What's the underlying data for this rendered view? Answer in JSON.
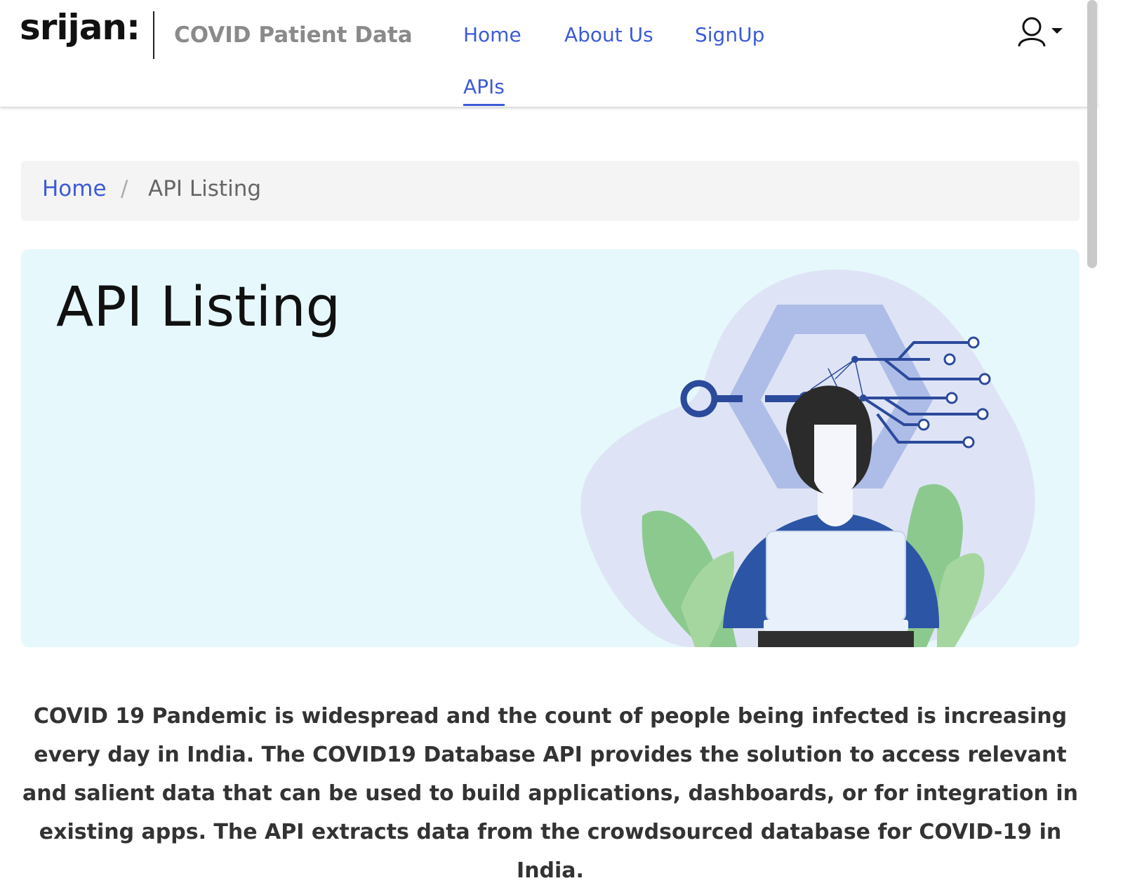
{
  "header": {
    "logo_text": "srijan:",
    "site_title": "COVID Patient Data",
    "nav": {
      "home": "Home",
      "about": "About Us",
      "signup": "SignUp",
      "apis": "APIs"
    }
  },
  "breadcrumb": {
    "home": "Home",
    "separator": "/",
    "current": "API Listing"
  },
  "hero": {
    "title": "API Listing"
  },
  "intro": {
    "text": "COVID 19 Pandemic is widespread and the count of people being infected is increasing every day in India. The COVID19 Database API provides the solution to access relevant and salient data that can be used to build applications, dashboards, or for integration in existing apps. The API extracts data from the crowdsourced database for COVID-19 in India."
  },
  "icons": {
    "user": "user-icon",
    "caret": "caret-down-icon"
  },
  "colors": {
    "link": "#3c5bd6",
    "hero_bg": "#e6f8fb",
    "breadcrumb_bg": "#f4f4f4"
  }
}
